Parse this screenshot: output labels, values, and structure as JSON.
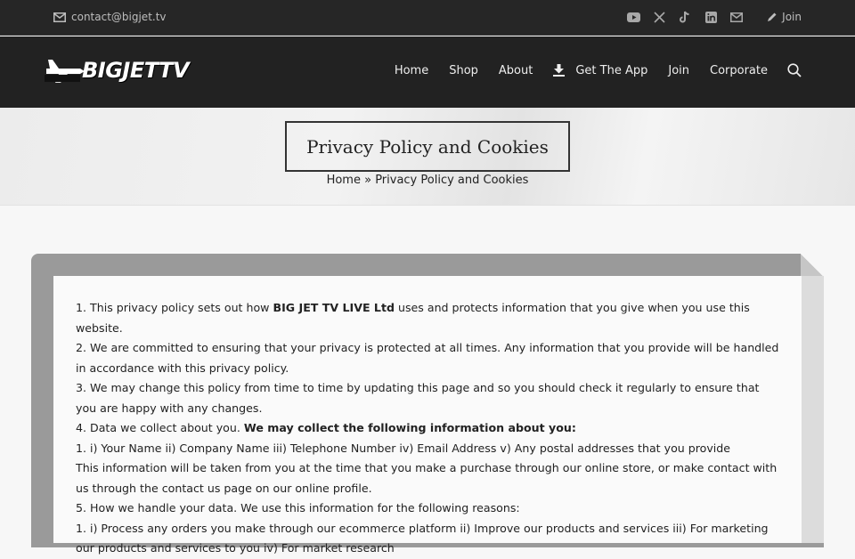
{
  "topbar": {
    "email": "contact@bigjet.tv",
    "social_icons": [
      "youtube-icon",
      "x-icon",
      "tiktok-icon",
      "linkedin-icon",
      "mail-icon"
    ],
    "join_label": "Join"
  },
  "header": {
    "logo_text": "BIGJETTV",
    "nav": [
      "Home",
      "Shop",
      "About",
      "Get The App",
      "Join",
      "Corporate"
    ]
  },
  "hero": {
    "title": "Privacy Policy and Cookies",
    "breadcrumb_home": "Home",
    "breadcrumb_sep": " » ",
    "breadcrumb_current": "Privacy Policy and Cookies"
  },
  "policy": {
    "l1_pre": "1. This privacy policy sets out how ",
    "l1_bold": "BIG JET TV LIVE Ltd",
    "l1_post": " uses and protects information that you give when you use this website.",
    "l2": "2. We are committed to ensuring that your privacy is protected at all times. Any information that you provide will be handled in accordance with this privacy policy.",
    "l3": "3. We may change this policy from time to time by updating this page and so you should check it regularly to ensure that you are happy with any changes.",
    "l4_pre": "4. Data we collect about you. ",
    "l4_bold": "We may collect the following information about you:",
    "l5": "1. i) Your Name ii) Company Name iii) Telephone Number iv) Email Address v) Any postal addresses that you provide",
    "l6": "This information will be taken from you at the time that you make a purchase through our online store, or make contact with us through the contact us page on our online profile.",
    "l7": "5. How we handle your data. We use this information for the following reasons:",
    "l8": "1. i) Process any orders you make through our ecommerce platform ii) Improve our products and services iii) For marketing our products and services to you iv) For market research"
  },
  "colors": {
    "topbar_bg": "#262626",
    "header_bg": "#222222",
    "frame_gray": "#9a9a9a"
  }
}
